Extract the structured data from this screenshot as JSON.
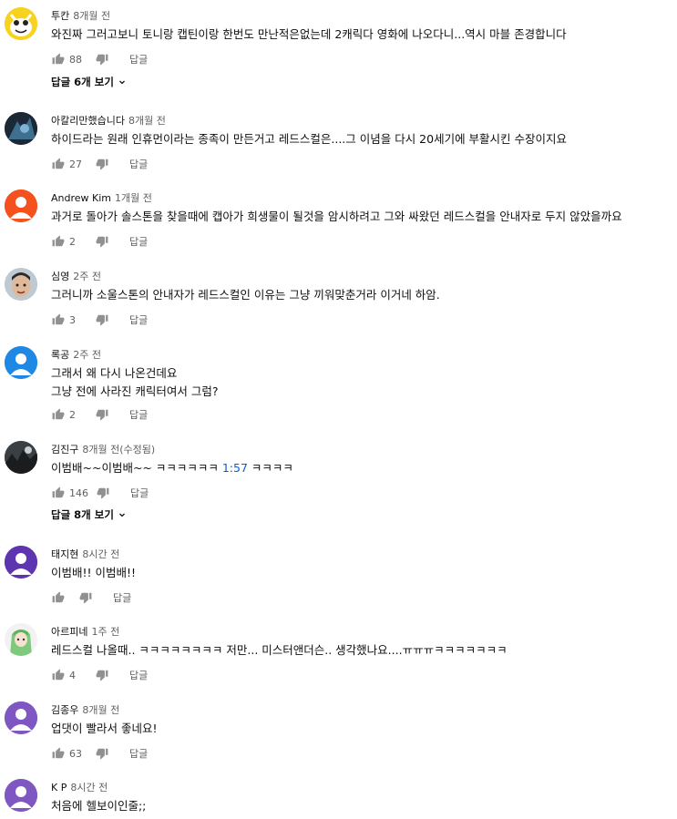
{
  "comments": [
    {
      "author": "투칸",
      "time": "8개월 전",
      "lines": [
        "와진짜 그러고보니 토니랑 캡틴이랑 한번도 만난적은없는데 2캐릭다 영화에 나오다니...역시 마블 존경합니다"
      ],
      "likes": "88",
      "reply_label": "답글",
      "view_replies": "답글 6개 보기"
    },
    {
      "author": "아칼리만했습니다",
      "time": "8개월 전",
      "lines": [
        "하이드라는 원래 인휴먼이라는 종족이 만든거고 레드스컬은....그 이념을 다시 20세기에 부활시킨 수장이지요"
      ],
      "likes": "27",
      "reply_label": "답글"
    },
    {
      "author": "Andrew Kim",
      "time": "1개월 전",
      "lines": [
        "과거로 돌아가 솔스톤을 찾을때에 캡아가 희생물이 될것을 암시하려고 그와 싸왔던 레드스컬을 안내자로 두지 않았을까요"
      ],
      "likes": "2",
      "reply_label": "답글"
    },
    {
      "author": "심영",
      "time": "2주 전",
      "lines": [
        "그러니까 소울스톤의 안내자가 레드스컬인 이유는 그냥 끼워맞춘거라 이거네 하암."
      ],
      "likes": "3",
      "reply_label": "답글"
    },
    {
      "author": "록공",
      "time": "2주 전",
      "lines": [
        "그래서 왜 다시 나온건데요",
        "그냥 전에 사라진 캐릭터여서 그럼?"
      ],
      "likes": "2",
      "reply_label": "답글"
    },
    {
      "author": "김진구",
      "time": "8개월 전(수정됨)",
      "text_pre": "이범배~~이범배~~  ㅋㅋㅋㅋㅋㅋ ",
      "timestamp": "1:57",
      "text_post": " ㅋㅋㅋㅋ",
      "likes": "146",
      "reply_label": "답글",
      "view_replies": "답글 8개 보기"
    },
    {
      "author": "태지현",
      "time": "8시간 전",
      "lines": [
        "이범배!! 이범배!!"
      ],
      "likes": "",
      "reply_label": "답글"
    },
    {
      "author": "아르피네",
      "time": "1주 전",
      "lines": [
        "레드스컬 나올때.. ㅋㅋㅋㅋㅋㅋㅋㅋ 저만... 미스터앤더슨.. 생각했나요....ㅠㅠㅠㅋㅋㅋㅋㅋㅋㅋ"
      ],
      "likes": "4",
      "reply_label": "답글"
    },
    {
      "author": "김종우",
      "time": "8개월 전",
      "lines": [
        "업댓이 빨라서 좋네요!"
      ],
      "likes": "63",
      "reply_label": "답글"
    },
    {
      "author": "K P",
      "time": "8시간 전",
      "lines": [
        "처음에 헬보이인줄;;"
      ]
    }
  ],
  "colors": {
    "avatar_bluebird": "#4aa3df",
    "avatar_orange": "#f4511e",
    "avatar_blue": "#1e88e5",
    "avatar_purple": "#5c6bc0",
    "avatar_violet": "#7e57c2",
    "link_blue": "#065fd4"
  },
  "icons": {
    "like": "thumb-up-icon",
    "dislike": "thumb-down-icon",
    "expand": "chevron-down-icon"
  }
}
